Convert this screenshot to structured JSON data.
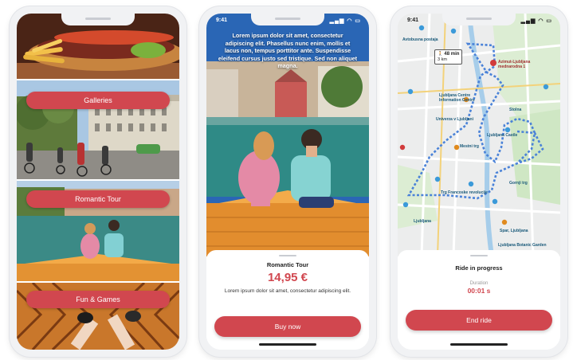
{
  "screens": {
    "categories": {
      "items": [
        {
          "label": ""
        },
        {
          "label": "Galleries"
        },
        {
          "label": "Romantic Tour"
        },
        {
          "label": "Fun & Games"
        }
      ]
    },
    "tour_detail": {
      "status_time": "9:41",
      "overlay_text": "Lorem ipsum dolor sit amet, consectetur adipiscing elit. Phasellus nunc enim, mollis et lacus non, tempus porttitor ante. Suspendisse eleifend cursus justo sed tristique. Sed non aliquet magna.",
      "title": "Romantic Tour",
      "price": "14,95 €",
      "description": "Lorem ipsum dolor sit amet, consectetur adipiscing elit.",
      "buy_label": "Buy now"
    },
    "ride": {
      "status_time": "9:41",
      "route_badge_time": "48 min",
      "route_badge_sub": "3 km",
      "map_labels": [
        {
          "text": "Avtobusna postaja"
        },
        {
          "text": "Azimut-Ljubljana mednarodna 1"
        },
        {
          "text": "Ljubljana Centre Information Centre"
        },
        {
          "text": "Univerza v Ljubljani"
        },
        {
          "text": "Ljubljana Castle"
        },
        {
          "text": "Mestni trg"
        },
        {
          "text": "Stolna"
        },
        {
          "text": "Trg Francoske revolucije"
        },
        {
          "text": "Gornji trg"
        },
        {
          "text": "Spar, Ljubljana"
        },
        {
          "text": "Ljubljana Botanic Garden"
        },
        {
          "text": "Ljubljana"
        }
      ],
      "title": "Ride in progress",
      "duration_label": "Duration",
      "duration_value": "00:01 s",
      "end_label": "End ride"
    }
  },
  "colors": {
    "accent": "#d1474f",
    "route": "#4a82d8",
    "phone_frame": "#f1f2f4"
  },
  "icons": {
    "status_right": "signal-wifi-battery-icons"
  }
}
